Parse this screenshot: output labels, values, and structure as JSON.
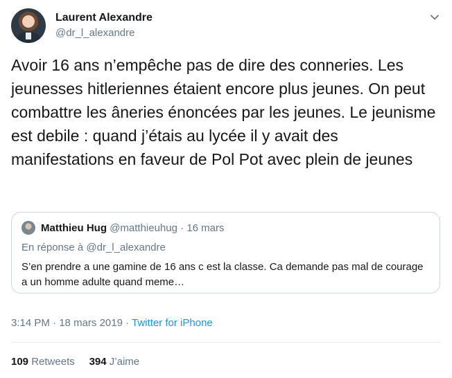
{
  "author": {
    "name": "Laurent Alexandre",
    "handle": "@dr_l_alexandre"
  },
  "tweet": {
    "text": "Avoir 16 ans n’empêche pas de dire des conneries. Les jeunesses hitleriennes étaient encore plus jeunes. On peut combattre les âneries énoncées par les jeunes. Le jeunisme est debile : quand j’étais au lycée il y avait des manifestations en faveur de Pol Pot avec plein de jeunes"
  },
  "quoted": {
    "name": "Matthieu Hug",
    "handle": "@matthieuhug",
    "separator": "·",
    "date": "16 mars",
    "reply_to": "En réponse à @dr_l_alexandre",
    "text": "S’en prendre a une gamine de 16 ans c est la classe. Ca demande pas mal de courage a un homme adulte quand meme…"
  },
  "meta": {
    "time": "3:14 PM",
    "separator": "·",
    "date": "18 mars 2019",
    "source": "Twitter for iPhone"
  },
  "stats": {
    "retweets_count": "109",
    "retweets_label": "Retweets",
    "likes_count": "394",
    "likes_label": "J’aime"
  },
  "colors": {
    "link": "#1b95e0",
    "secondary_text": "#657786",
    "border": "#ccd6dd"
  },
  "icons": {
    "menu": "chevron-down-icon"
  }
}
